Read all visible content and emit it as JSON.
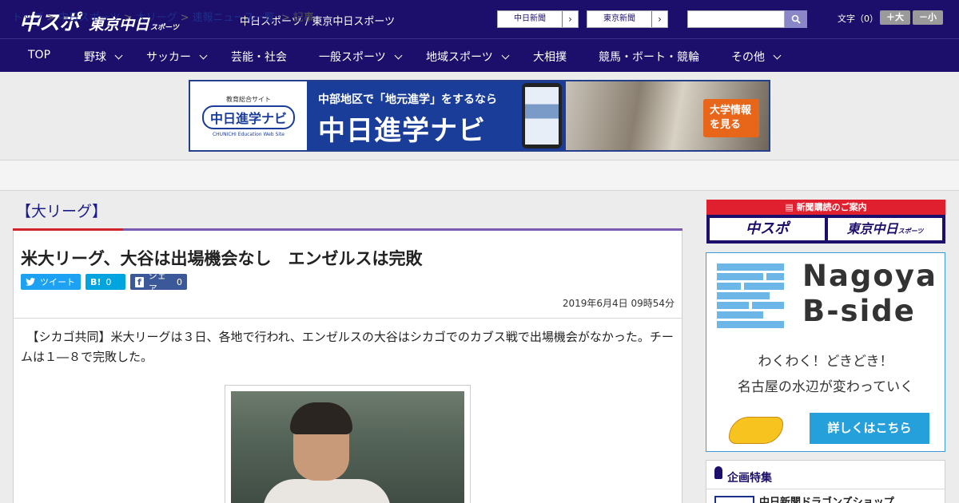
{
  "header": {
    "logo_main": "中スポ",
    "logo_sub": "東京中日",
    "logo_sub_small": "スポーツ",
    "site_title": "中日スポーツ / 東京中日スポーツ",
    "paper_buttons": [
      "中日新聞",
      "東京新聞"
    ],
    "font_size_label": "文字（0）",
    "font_larger": "＋大",
    "font_smaller": "－小"
  },
  "nav": {
    "items": [
      {
        "label": "TOP"
      },
      {
        "label": "野球"
      },
      {
        "label": "サッカー"
      },
      {
        "label": "芸能・社会"
      },
      {
        "label": "一般スポーツ"
      },
      {
        "label": "地域スポーツ"
      },
      {
        "label": "大相撲"
      },
      {
        "label": "競馬・ボート・競輪"
      },
      {
        "label": "その他"
      }
    ]
  },
  "banner": {
    "logo_small": "教育総合サイト",
    "logo_mark": "中日進学ナビ",
    "logo_en": "CHUNICHI Education Web Site",
    "line1": "中部地区で「地元進学」をするなら",
    "line2": "中日進学ナビ",
    "cta": "大学情報を見る"
  },
  "breadcrumb": {
    "items": [
      "トップ",
      "中日スポーツ",
      "大リーグ",
      "速報ニュース一覧"
    ],
    "current": "記事"
  },
  "article": {
    "category": "【大リーグ】",
    "headline": "米大リーグ、大谷は出場機会なし　エンゼルスは完敗",
    "share": {
      "tweet": "ツイート",
      "hatena_icon": "B!",
      "hatena_count": "0",
      "facebook_icon": "f",
      "facebook_label": "シェア",
      "facebook_count": "0"
    },
    "date": "2019年6月4日 09時54分",
    "body": "　【シカゴ共同】米大リーグは３日、各地で行われ、エンゼルスの大谷はシカゴでのカブス戦で出場機会がなかった。チームは１―８で完敗した。"
  },
  "sidebar": {
    "subscription_header": "新聞購読のご案内",
    "subscription_logos": [
      "中スポ",
      "東京中日"
    ],
    "subscription_logo_small": "スポーツ",
    "bside_title_1": "Nagoya",
    "bside_title_2": "B-side",
    "bside_line1": "わくわく！どきどき！",
    "bside_line2": "名古屋の水辺が変わっていく",
    "bside_button": "詳しくはこちら",
    "feature_title": "企画特集",
    "feature_item": "中日新聞ドラゴンズショップ"
  },
  "colors": {
    "brand_navy": "#1c0f6b",
    "accent_red": "#d2232a",
    "accent_purple": "#7b5bb0",
    "twitter": "#1da1f2",
    "hatena": "#00a4de",
    "facebook": "#3b5998",
    "bside_blue": "#26a0da"
  }
}
